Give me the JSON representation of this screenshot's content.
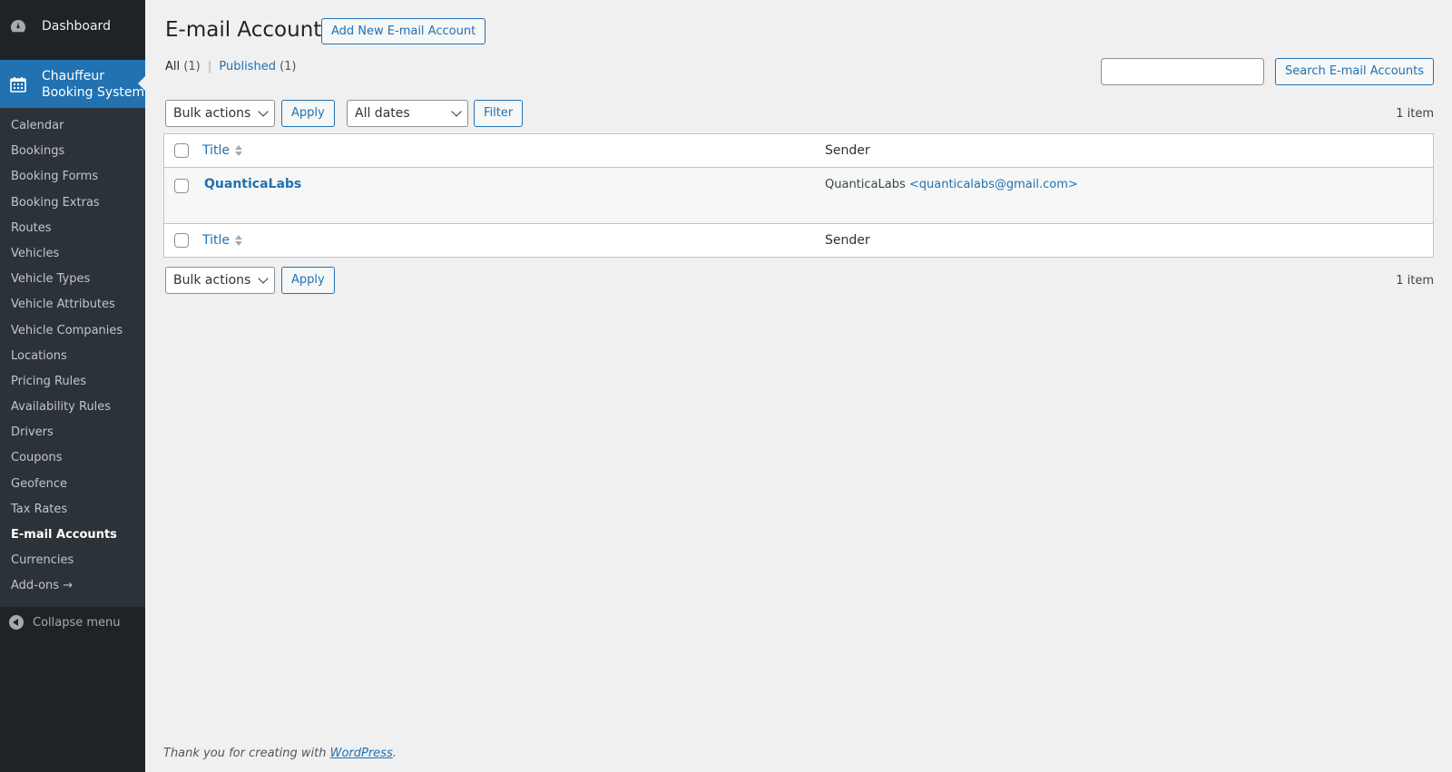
{
  "sidebar": {
    "dashboard_label": "Dashboard",
    "plugin_label_line1": "Chauffeur",
    "plugin_label_line2": "Booking System",
    "items": [
      {
        "label": "Calendar"
      },
      {
        "label": "Bookings"
      },
      {
        "label": "Booking Forms"
      },
      {
        "label": "Booking Extras"
      },
      {
        "label": "Routes"
      },
      {
        "label": "Vehicles"
      },
      {
        "label": "Vehicle Types"
      },
      {
        "label": "Vehicle Attributes"
      },
      {
        "label": "Vehicle Companies"
      },
      {
        "label": "Locations"
      },
      {
        "label": "Pricing Rules"
      },
      {
        "label": "Availability Rules"
      },
      {
        "label": "Drivers"
      },
      {
        "label": "Coupons"
      },
      {
        "label": "Geofence"
      },
      {
        "label": "Tax Rates"
      },
      {
        "label": "E-mail Accounts",
        "current": true
      },
      {
        "label": "Currencies"
      },
      {
        "label": "Add-ons →"
      }
    ],
    "collapse_label": "Collapse menu"
  },
  "header": {
    "title": "E-mail Accounts",
    "add_new_label": "Add New E-mail Account"
  },
  "views": {
    "all_label": "All",
    "all_count": "(1)",
    "published_label": "Published",
    "published_count": "(1)"
  },
  "search": {
    "value": "",
    "button_label": "Search E-mail Accounts"
  },
  "tablenav": {
    "bulk_actions": "Bulk actions",
    "apply_label": "Apply",
    "dates_filter": "All dates",
    "filter_label": "Filter",
    "items_count": "1 item"
  },
  "table": {
    "columns": [
      "Title",
      "Sender"
    ],
    "rows": [
      {
        "title": "QuanticaLabs",
        "sender_name": "QuanticaLabs",
        "sender_email": "<quanticalabs@gmail.com>"
      }
    ]
  },
  "footer": {
    "text": "Thank you for creating with",
    "link": "WordPress",
    "suffix": "."
  },
  "colors": {
    "sidebar_bg": "#1d2327",
    "accent": "#2271b1",
    "page_bg": "#f0f0f1"
  }
}
